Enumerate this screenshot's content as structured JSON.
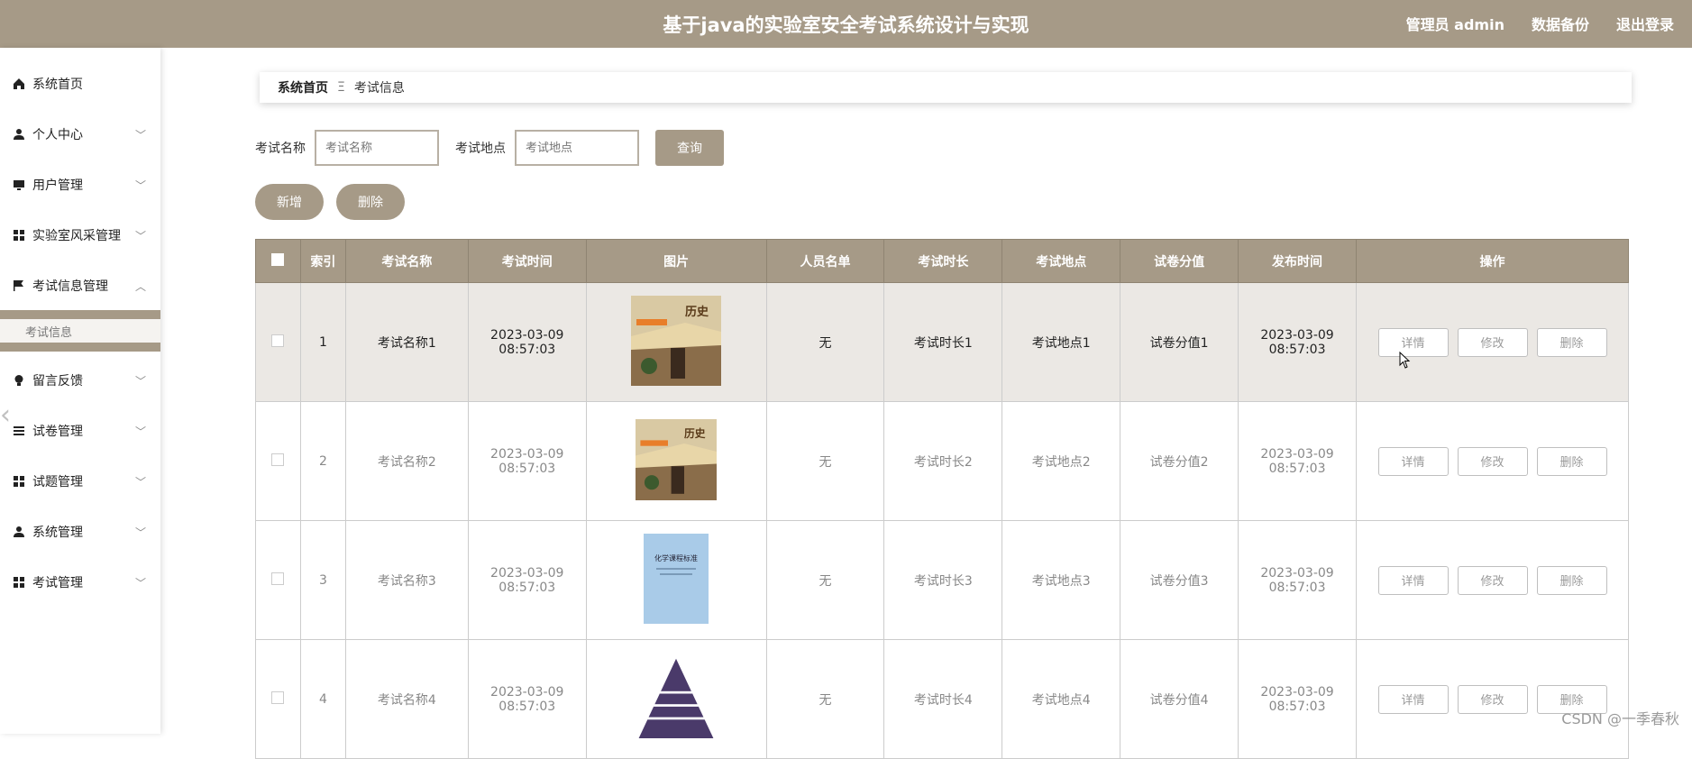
{
  "header": {
    "title": "基于java的实验室安全考试系统设计与实现",
    "admin": "管理员 admin",
    "backup": "数据备份",
    "logout": "退出登录"
  },
  "sidebar": {
    "items": [
      {
        "label": "系统首页",
        "icon": "home-icon"
      },
      {
        "label": "个人中心",
        "icon": "user-icon"
      },
      {
        "label": "用户管理",
        "icon": "monitor-icon"
      },
      {
        "label": "实验室风采管理",
        "icon": "grid-icon"
      },
      {
        "label": "考试信息管理",
        "icon": "flag-icon"
      },
      {
        "label": "留言反馈",
        "icon": "bulb-icon"
      },
      {
        "label": "试卷管理",
        "icon": "list-icon"
      },
      {
        "label": "试题管理",
        "icon": "grid-icon"
      },
      {
        "label": "系统管理",
        "icon": "user-icon"
      },
      {
        "label": "考试管理",
        "icon": "grid-icon"
      }
    ],
    "active_sub": "考试信息"
  },
  "breadcrumb": {
    "home": "系统首页",
    "sep": "Ξ",
    "current": "考试信息"
  },
  "search": {
    "name_label": "考试名称",
    "name_placeholder": "考试名称",
    "place_label": "考试地点",
    "place_placeholder": "考试地点",
    "query": "查询"
  },
  "actions": {
    "add": "新增",
    "delete": "删除"
  },
  "table": {
    "headers": [
      "索引",
      "考试名称",
      "考试时间",
      "图片",
      "人员名单",
      "考试时长",
      "考试地点",
      "试卷分值",
      "发布时间",
      "操作"
    ],
    "op_labels": {
      "detail": "详情",
      "edit": "修改",
      "delete": "删除"
    },
    "rows": [
      {
        "index": "1",
        "name": "考试名称1",
        "time": "2023-03-09 08:57:03",
        "people": "无",
        "duration": "考试时长1",
        "place": "考试地点1",
        "score": "试卷分值1",
        "publish": "2023-03-09 08:57:03"
      },
      {
        "index": "2",
        "name": "考试名称2",
        "time": "2023-03-09 08:57:03",
        "people": "无",
        "duration": "考试时长2",
        "place": "考试地点2",
        "score": "试卷分值2",
        "publish": "2023-03-09 08:57:03"
      },
      {
        "index": "3",
        "name": "考试名称3",
        "time": "2023-03-09 08:57:03",
        "people": "无",
        "duration": "考试时长3",
        "place": "考试地点3",
        "score": "试卷分值3",
        "publish": "2023-03-09 08:57:03"
      },
      {
        "index": "4",
        "name": "考试名称4",
        "time": "2023-03-09 08:57:03",
        "people": "无",
        "duration": "考试时长4",
        "place": "考试地点4",
        "score": "试卷分值4",
        "publish": "2023-03-09 08:57:03"
      }
    ]
  },
  "images": {
    "book1": "历史",
    "book3": "化学课程标准"
  },
  "watermark": "CSDN @一季春秋",
  "colors": {
    "accent": "#a69a87",
    "row_highlight": "#ebe8e4"
  }
}
